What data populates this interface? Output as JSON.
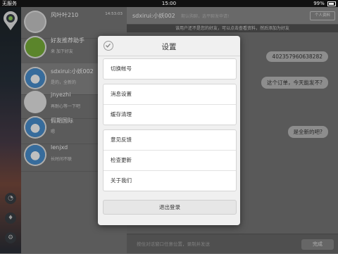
{
  "status_bar": {
    "carrier": "无服务",
    "time": "15:00",
    "battery": "99%"
  },
  "contacts": [
    {
      "name": "风叶叶210",
      "message": "",
      "time": "14:53:03",
      "avatar": "ff-icon"
    },
    {
      "name": "好友推荐助手",
      "message": "来 加下好友",
      "time": "",
      "avatar": "helper-icon"
    },
    {
      "name": "sdxirui:小妖002",
      "message": "是的，全新的",
      "time": "",
      "avatar": "person-icon"
    },
    {
      "name": "jnyezhi",
      "message": "再耐心等一下吧",
      "time": "",
      "avatar": "brand-logo-icon"
    },
    {
      "name": "假期国际",
      "message": "嗯",
      "time": "",
      "avatar": "person-icon"
    },
    {
      "name": "lenjxd",
      "message": "长时间不联",
      "time": "",
      "avatar": "person-icon"
    }
  ],
  "chat": {
    "title": "sdxirui:小妖002",
    "subtitle": "期认购聊，选平聊发申请!",
    "profile_button": "个人资料",
    "notice": "该用户还不是您的好友，可以点击查看资料，然后添加为好友",
    "messages": [
      {
        "text": "402357960638282"
      },
      {
        "text": "这个订单，今天能发不?"
      },
      {
        "text": "是全新的吧?"
      }
    ],
    "input_placeholder": "按住对话窗口任意位置，录制并发送",
    "send_button": "完成"
  },
  "settings_dialog": {
    "title": "设置",
    "group1": [
      "切换帐号"
    ],
    "group2": [
      "消息设置",
      "缓存清理"
    ],
    "group3": [
      "意见反馈",
      "检查更新",
      "关于我们"
    ],
    "logout_button": "退出登录"
  }
}
